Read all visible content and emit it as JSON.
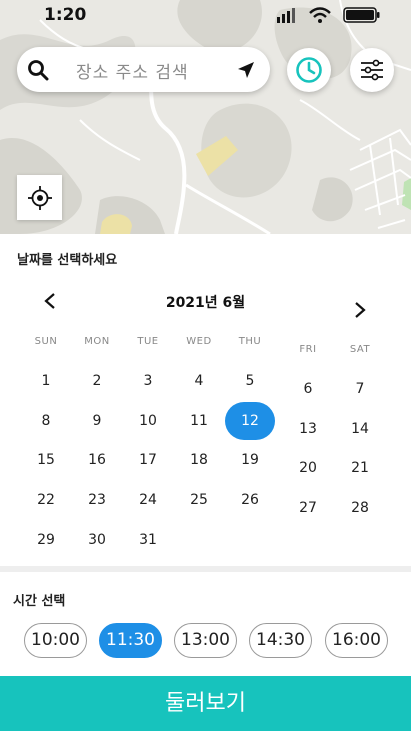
{
  "status_bar": {
    "time": "1:20"
  },
  "search": {
    "placeholder": "장소 주소 검색"
  },
  "icons": {
    "search": "search-icon",
    "navigate": "navigation-arrow-icon",
    "history": "clock-icon",
    "filter": "filter-sliders-icon",
    "locate": "crosshair-icon",
    "prev": "chevron-left-icon",
    "next": "chevron-right-icon"
  },
  "colors": {
    "accent": "#1e8fe6",
    "cta": "#17c3bd",
    "history_icon": "#17c3bd"
  },
  "date_section": {
    "title": "날짜를 선택하세요"
  },
  "calendar": {
    "month_label": "2021년 6월",
    "weekdays": [
      "SUN",
      "MON",
      "TUE",
      "WED",
      "THU",
      "FRI",
      "SAT"
    ],
    "weeks": [
      [
        "",
        "",
        "",
        "",
        "",
        "",
        ""
      ],
      [
        "1",
        "2",
        "3",
        "4",
        "5",
        "6",
        "7"
      ],
      [
        "8",
        "9",
        "10",
        "11",
        "12",
        "13",
        "14"
      ],
      [
        "15",
        "16",
        "17",
        "18",
        "19",
        "20",
        "21"
      ],
      [
        "22",
        "23",
        "24",
        "25",
        "26",
        "27",
        "28"
      ],
      [
        "29",
        "30",
        "31"
      ]
    ],
    "selected_day": "12"
  },
  "time_section": {
    "title": "시간 선택",
    "slots": [
      "10:00",
      "11:30",
      "13:00",
      "14:30",
      "16:00"
    ],
    "selected": "11:30"
  },
  "cta": {
    "label": "둘러보기"
  }
}
